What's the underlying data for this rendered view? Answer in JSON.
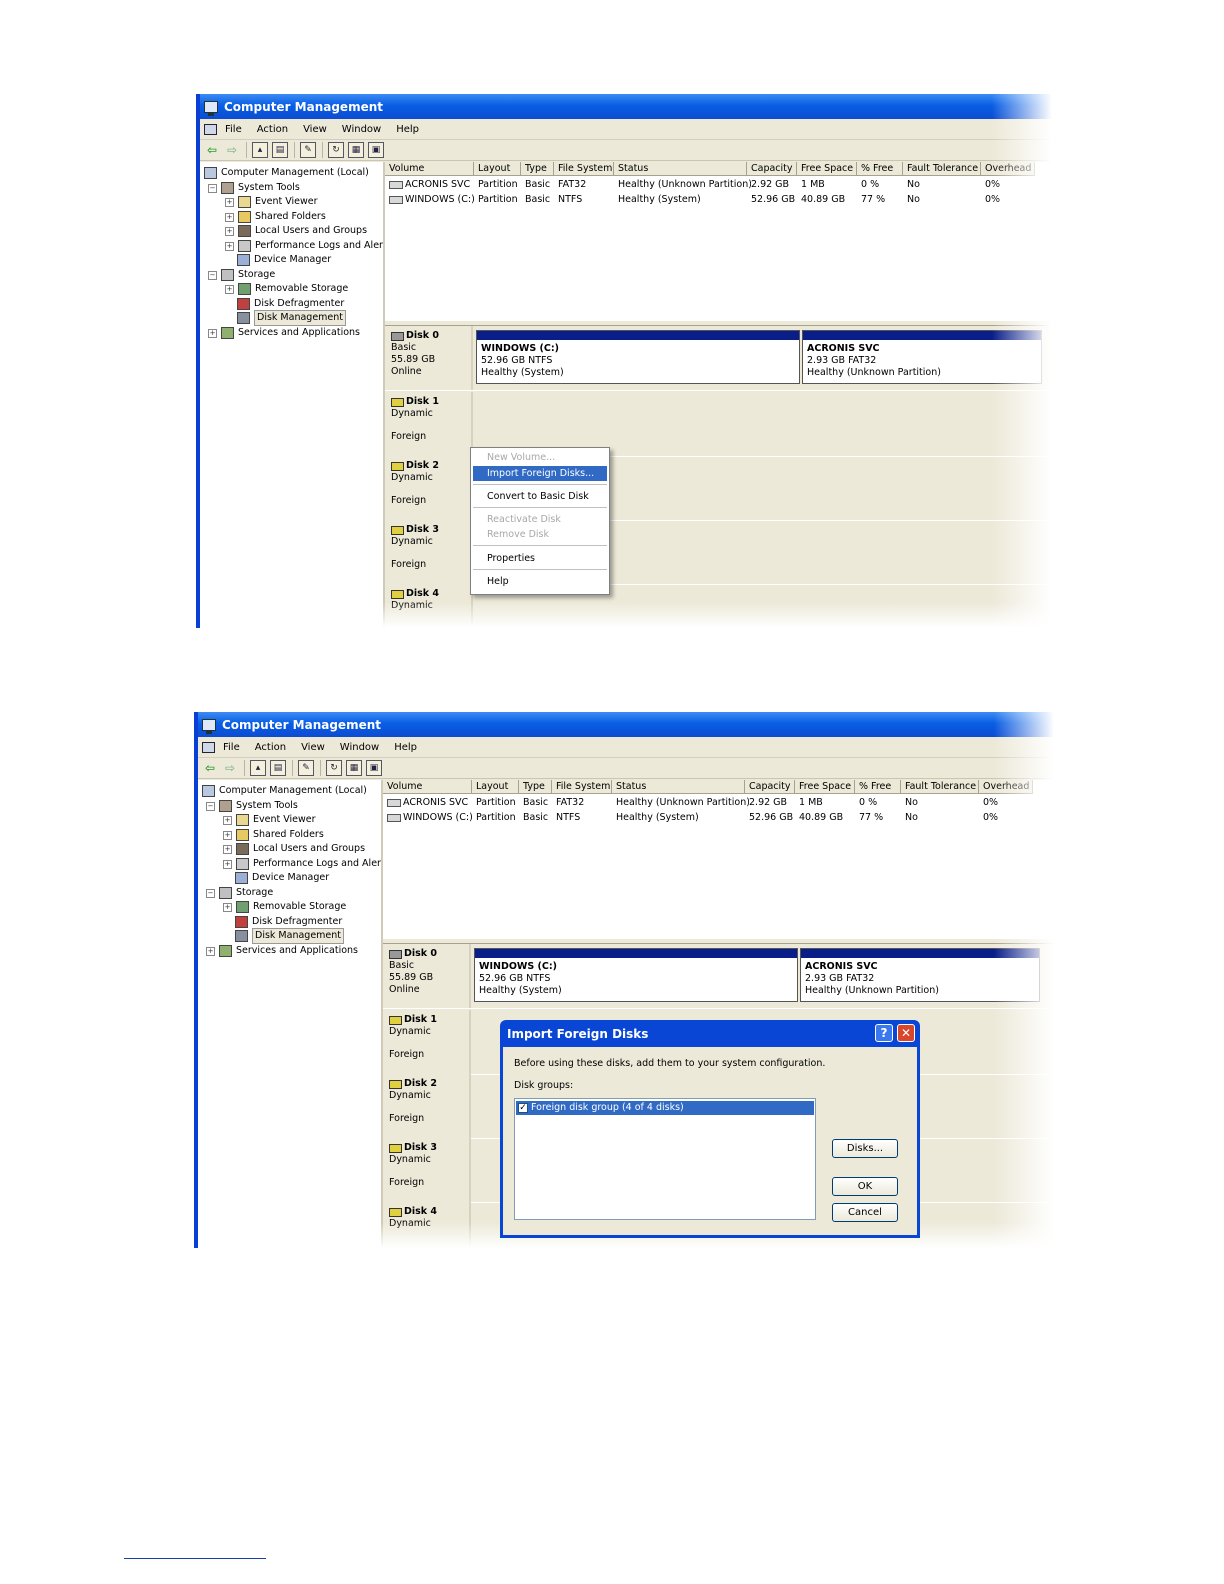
{
  "colors": {
    "titlebar": "#0a5ee4",
    "selection": "#316ac5",
    "partition_bar": "#0a1e8a",
    "window_bg": "#ece9d8"
  },
  "window": {
    "title": "Computer Management"
  },
  "menu": [
    "File",
    "Action",
    "View",
    "Window",
    "Help"
  ],
  "toolbar_icons": [
    "back-arrow-icon",
    "forward-arrow-icon",
    "up-folder-icon",
    "show-hide-tree-icon",
    "properties-icon",
    "refresh-icon",
    "export-icon",
    "help-icon"
  ],
  "tree": {
    "root": "Computer Management (Local)",
    "system_tools": "System Tools",
    "event_viewer": "Event Viewer",
    "shared_folders": "Shared Folders",
    "local_users": "Local Users and Groups",
    "perf_logs": "Performance Logs and Alerts",
    "device_manager": "Device Manager",
    "storage": "Storage",
    "removable_storage": "Removable Storage",
    "disk_defrag": "Disk Defragmenter",
    "disk_management": "Disk Management",
    "services": "Services and Applications"
  },
  "columns": [
    "Volume",
    "Layout",
    "Type",
    "File System",
    "Status",
    "Capacity",
    "Free Space",
    "% Free",
    "Fault Tolerance",
    "Overhead"
  ],
  "volumes": [
    [
      "ACRONIS SVC",
      "Partition",
      "Basic",
      "FAT32",
      "Healthy (Unknown Partition)",
      "2.92 GB",
      "1 MB",
      "0 %",
      "No",
      "0%"
    ],
    [
      "WINDOWS (C:)",
      "Partition",
      "Basic",
      "NTFS",
      "Healthy (System)",
      "52.96 GB",
      "40.89 GB",
      "77 %",
      "No",
      "0%"
    ]
  ],
  "disks": {
    "d0": {
      "name": "Disk 0",
      "type": "Basic",
      "size": "55.89 GB",
      "state": "Online"
    },
    "d1": {
      "name": "Disk 1",
      "type": "Dynamic",
      "state": "Foreign"
    },
    "d2": {
      "name": "Disk 2",
      "type": "Dynamic",
      "state": "Foreign"
    },
    "d3": {
      "name": "Disk 3",
      "type": "Dynamic",
      "state": "Foreign"
    },
    "d4": {
      "name": "Disk 4",
      "type": "Dynamic"
    }
  },
  "partitions": {
    "windows": {
      "name": "WINDOWS  (C:)",
      "size1": "52.96 GB NTFS",
      "size2": "52.96 GB NTFS",
      "status": "Healthy (System)"
    },
    "acronis": {
      "name": "ACRONIS SVC",
      "size1": "2.93 GB FAT32",
      "size2": "2.93 GB FAT32",
      "status": "Healthy (Unknown Partition)"
    }
  },
  "context_menu": {
    "new_volume": "New Volume...",
    "import": "Import Foreign Disks...",
    "convert": "Convert to Basic Disk",
    "reactivate": "Reactivate Disk",
    "remove": "Remove Disk",
    "properties": "Properties",
    "help": "Help"
  },
  "dialog": {
    "title": "Import Foreign Disks",
    "instruction": "Before using these disks, add them to your system configuration.",
    "groups_label": "Disk groups:",
    "group_item": "Foreign disk group (4 of 4 disks)",
    "disks_button": "Disks...",
    "ok_button": "OK",
    "cancel_button": "Cancel",
    "help_glyph": "?",
    "close_glyph": "✕"
  }
}
